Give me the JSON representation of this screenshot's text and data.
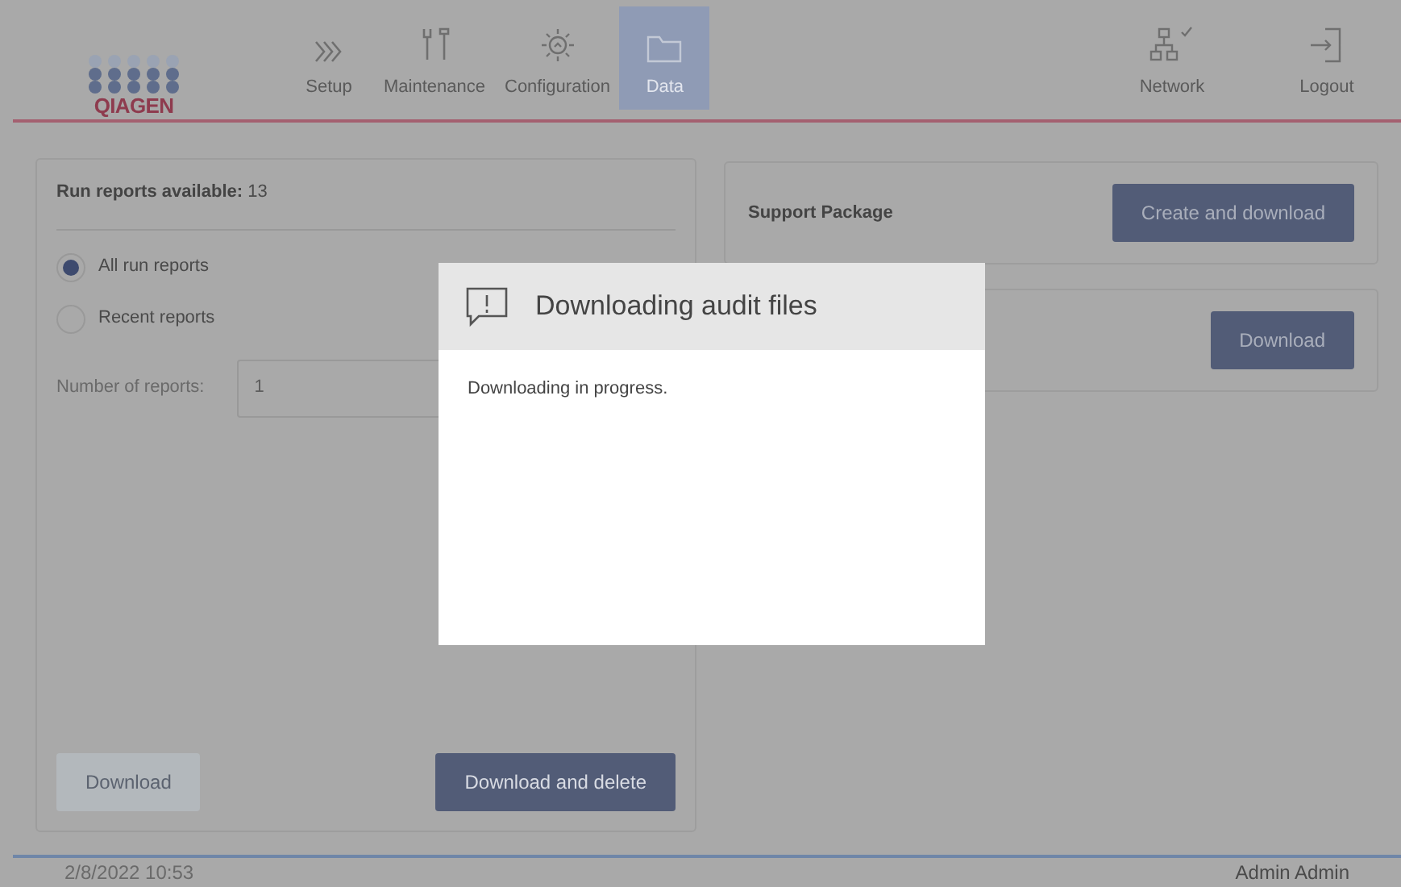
{
  "header": {
    "logo": "QIAGEN",
    "nav": [
      {
        "label": "Setup",
        "selected": false
      },
      {
        "label": "Maintenance",
        "selected": false
      },
      {
        "label": "Configuration",
        "selected": false
      },
      {
        "label": "Data",
        "selected": true
      }
    ],
    "right_nav": [
      {
        "label": "Network"
      },
      {
        "label": "Logout"
      }
    ]
  },
  "run_reports": {
    "label": "Run reports available:",
    "count": "13",
    "options": [
      {
        "label": "All run reports",
        "selected": true
      },
      {
        "label": "Recent reports",
        "selected": false
      }
    ],
    "number_field": {
      "label": "Number of reports:",
      "value": "1"
    },
    "buttons": [
      {
        "label": "Download",
        "disabled": true
      },
      {
        "label": "Download and delete",
        "disabled": false
      }
    ]
  },
  "panels": [
    {
      "label": "Support Package",
      "button": "Create and download"
    },
    {
      "button": "Download"
    }
  ],
  "dialog": {
    "title": "Downloading audit files",
    "message": "Downloading in progress."
  },
  "status_bar": {
    "datetime": "2/8/2022 10:53",
    "user": "Admin Admin"
  }
}
